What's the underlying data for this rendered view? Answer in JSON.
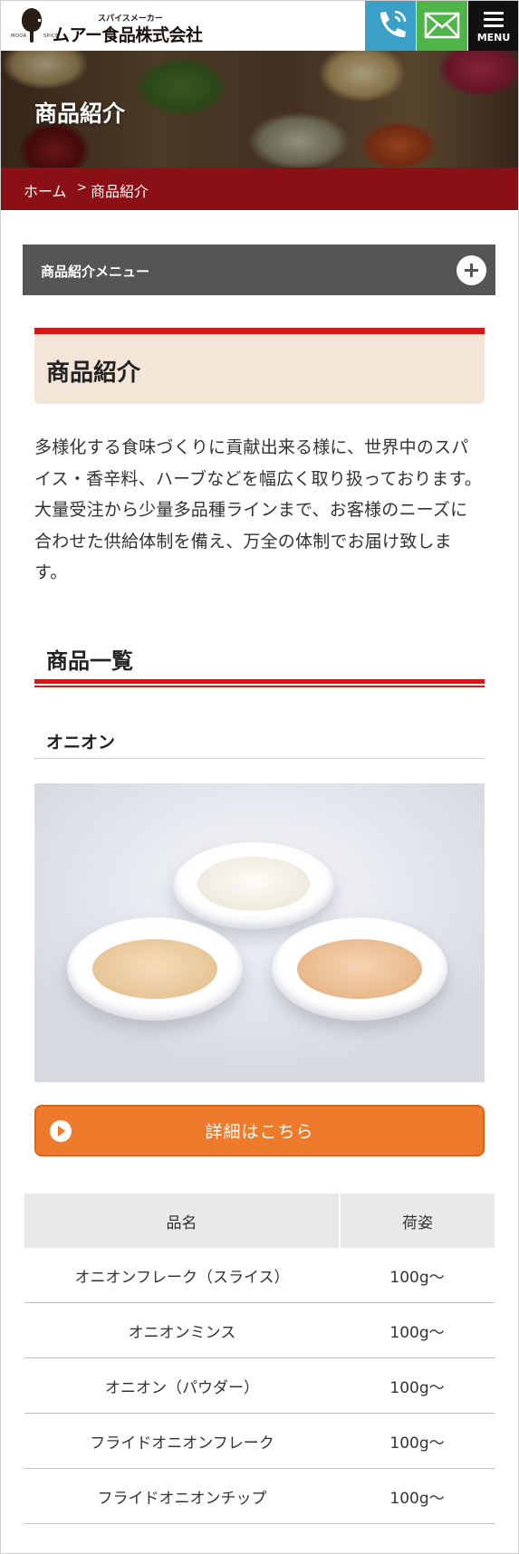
{
  "header": {
    "logo_small": "スパイスメーカー",
    "logo_name": "ムアー食品株式会社",
    "logo_tag_left": "MOOR",
    "logo_tag_right": "SPICE",
    "menu_label": "MENU",
    "colors": {
      "tel": "#3aa0c7",
      "mail": "#4fb548",
      "menu": "#111111"
    },
    "icons": [
      "phone-icon",
      "mail-icon",
      "hamburger-icon"
    ]
  },
  "hero": {
    "title": "商品紹介"
  },
  "breadcrumb": {
    "home": "ホーム",
    "separator": ">",
    "current": "商品紹介"
  },
  "accordion": {
    "label": "商品紹介メニュー",
    "icon": "plus-icon"
  },
  "section1": {
    "title": "商品紹介",
    "accent": "#d1191c"
  },
  "intro": "多様化する食味づくりに貢献出来る様に、世界中のスパイス・香辛料、ハーブなどを幅広く取り扱っております。大量受注から少量多品種ラインまで、お客様のニーズに合わせた供給体制を備え、万全の体制でお届け致します。",
  "section2": {
    "title": "商品一覧"
  },
  "product": {
    "name": "オニオン",
    "cta_label": "詳細はこちら",
    "cta_color": "#ee7b2c",
    "table": {
      "headers": [
        "品名",
        "荷姿"
      ],
      "rows": [
        [
          "オニオンフレーク（スライス）",
          "100g〜"
        ],
        [
          "オニオンミンス",
          "100g〜"
        ],
        [
          "オニオン（パウダー）",
          "100g〜"
        ],
        [
          "フライドオニオンフレーク",
          "100g〜"
        ],
        [
          "フライドオニオンチップ",
          "100g〜"
        ]
      ]
    }
  }
}
